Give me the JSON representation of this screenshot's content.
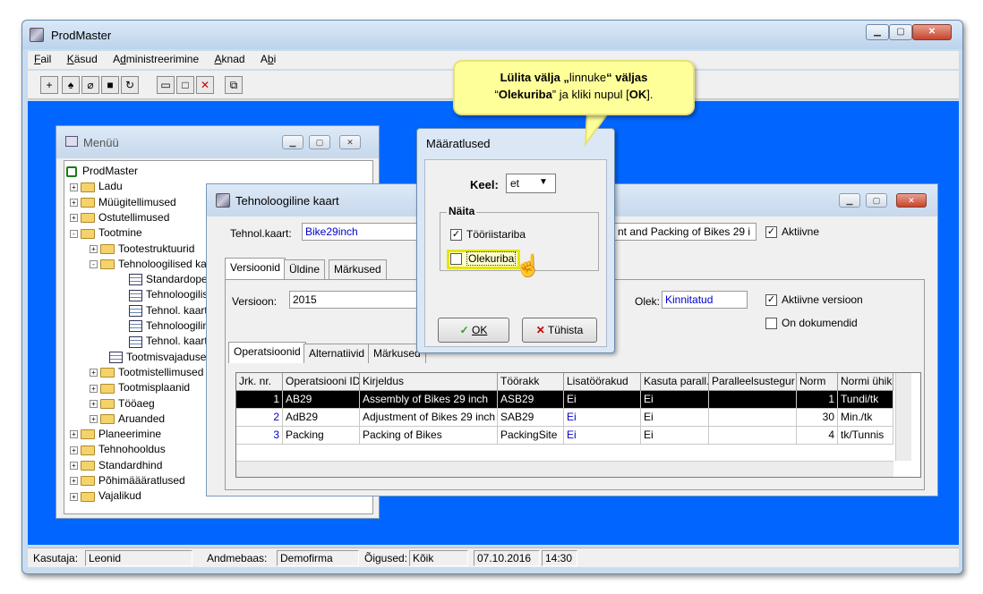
{
  "app": {
    "title": "ProdMaster"
  },
  "menubar": [
    {
      "key": "F",
      "rest": "ail"
    },
    {
      "key": "K",
      "rest": "äsud"
    },
    {
      "pre": "A",
      "key": "d",
      "rest": "ministreerimine"
    },
    {
      "key": "A",
      "rest": "knad"
    },
    {
      "pre": "A",
      "key": "b",
      "rest": "i"
    }
  ],
  "menu_window": {
    "title": "Menüü",
    "tree": [
      {
        "label": "ProdMaster",
        "type": "root",
        "indent": 0
      },
      {
        "label": "Ladu",
        "type": "folder",
        "indent": 1,
        "exp": "+"
      },
      {
        "label": "Müügitellimused",
        "type": "folder",
        "indent": 1,
        "exp": "+"
      },
      {
        "label": "Ostutellimused",
        "type": "folder",
        "indent": 1,
        "exp": "+"
      },
      {
        "label": "Tootmine",
        "type": "folder",
        "indent": 1,
        "exp": "-"
      },
      {
        "label": "Tootestruktuurid",
        "type": "folder",
        "indent": 2,
        "exp": "+"
      },
      {
        "label": "Tehnoloogilised ka",
        "type": "folder",
        "indent": 2,
        "exp": "-"
      },
      {
        "label": "Standardoperat",
        "type": "grid",
        "indent": 3
      },
      {
        "label": "Tehnoloogilise",
        "type": "grid",
        "indent": 3
      },
      {
        "label": "Tehnol. kaarti",
        "type": "grid",
        "indent": 3
      },
      {
        "label": "Tehnoloogiline",
        "type": "grid",
        "indent": 3
      },
      {
        "label": "Tehnol. kaarti",
        "type": "grid",
        "indent": 3
      },
      {
        "label": "Tootmisvajadused",
        "type": "grid",
        "indent": 2
      },
      {
        "label": "Tootmistellimused",
        "type": "folder",
        "indent": 2,
        "exp": "+"
      },
      {
        "label": "Tootmisplaanid",
        "type": "folder",
        "indent": 2,
        "exp": "+"
      },
      {
        "label": "Tööaeg",
        "type": "folder",
        "indent": 2,
        "exp": "+"
      },
      {
        "label": "Aruanded",
        "type": "folder",
        "indent": 2,
        "exp": "+"
      },
      {
        "label": "Planeerimine",
        "type": "folder",
        "indent": 1,
        "exp": "+"
      },
      {
        "label": "Tehnohooldus",
        "type": "folder",
        "indent": 1,
        "exp": "+"
      },
      {
        "label": "Standardhind",
        "type": "folder",
        "indent": 1,
        "exp": "+"
      },
      {
        "label": "Põhimäääratlused",
        "type": "folder",
        "indent": 1,
        "exp": "+"
      },
      {
        "label": "Vajalikud",
        "type": "folder",
        "indent": 1,
        "exp": "+"
      }
    ]
  },
  "tech_window": {
    "title": "Tehnoloogiline kaart",
    "card_label": "Tehnol.kaart:",
    "card_value": "Bike29inch",
    "desc_value": "nt and Packing of Bikes 29 i",
    "active_label": "Aktiivne",
    "tabs": [
      "Versioonid",
      "Üldine",
      "Märkused"
    ],
    "version_label": "Versioon:",
    "version_value": "2015",
    "status_label": "Olek:",
    "status_value": "Kinnitatud",
    "active_version_label": "Aktiivne versioon",
    "has_docs_label": "On dokumendid",
    "subtabs": [
      "Operatsioonid",
      "Alternatiivid",
      "Märkused"
    ],
    "columns": [
      "Jrk. nr.",
      "Operatsiooni ID",
      "Kirjeldus",
      "Töörakk",
      "Lisatöörakud",
      "Kasuta parall.",
      "Paralleelsustegur",
      "Norm",
      "Normi ühik"
    ],
    "rows": [
      [
        "1",
        "AB29",
        "Assembly of Bikes 29 inch",
        "ASB29",
        "Ei",
        "Ei",
        "",
        "1",
        "Tundi/tk"
      ],
      [
        "2",
        "AdB29",
        "Adjustment of Bikes 29 inch",
        "SAB29",
        "Ei",
        "Ei",
        "",
        "30",
        "Min./tk"
      ],
      [
        "3",
        "Packing",
        "Packing of Bikes",
        "PackingSite",
        "Ei",
        "Ei",
        "",
        "4",
        "tk/Tunnis"
      ]
    ]
  },
  "dialog": {
    "title": "Määratlused",
    "lang_label": "Keel:",
    "lang_value": "et",
    "group_label": "Näita",
    "toolbar_option": "Tööriistariba",
    "statusbar_option": "Olekuriba",
    "ok_label": "OK",
    "cancel_label": "Tühista"
  },
  "callout": {
    "line1_a": "Lülita välja „",
    "line1_b": "linnuke",
    "line1_c": "“ väljas",
    "line2_a": "“",
    "line2_b": "Olekuriba",
    "line2_c": "” ja kliki nupul [",
    "line2_d": "OK",
    "line2_e": "]."
  },
  "statusbar": {
    "user_label": "Kasutaja:",
    "user_value": "Leonid",
    "db_label": "Andmebaas:",
    "db_value": "Demofirma",
    "rights_label": "Õigused:",
    "rights_value": "Kõik",
    "date": "07.10.2016",
    "time": "14:30"
  }
}
